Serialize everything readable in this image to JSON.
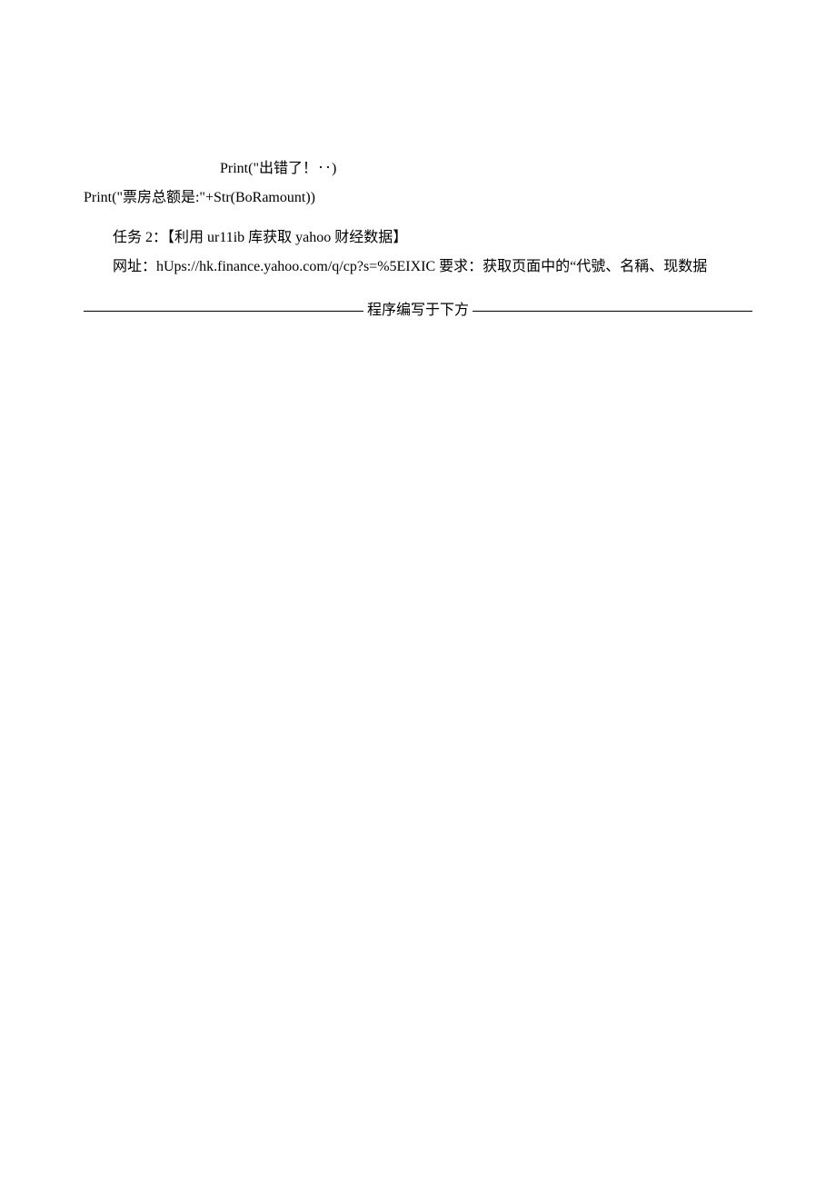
{
  "code": {
    "line1": "Print(\"出错了！‥)",
    "line2": "Print(\"票房总额是:\"+Str(BoRamount))"
  },
  "task": {
    "title": "任务 2：【利用 ur11ib 库获取 yahoo 财经数据】",
    "body": "网址：hUps://hk.finance.yahoo.com/q/cp?s=%5EIXIC 要求：获取页面中的“代號、名稱、现数据"
  },
  "divider": {
    "label": "程序编写于下方"
  }
}
